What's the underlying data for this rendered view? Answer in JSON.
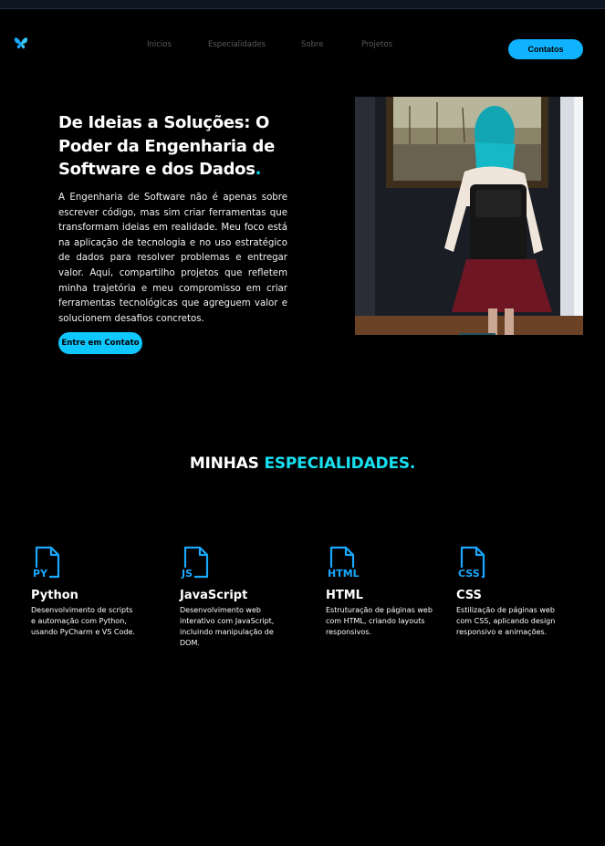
{
  "nav": {
    "items": [
      "Inicios",
      "Especialidades",
      "Sobre",
      "Projetos"
    ],
    "contact_button": "Contatos"
  },
  "hero": {
    "title": "De Ideias a Soluções: O Poder da Engenharia de Software e dos Dados",
    "title_dot": ".",
    "description": "A Engenharia de Software não é apenas sobre escrever código, mas sim criar ferramentas que transformam ideias em realidade. Meu foco está na aplicação de tecnologia e no uso estratégico de dados para resolver problemas e entregar valor. Aqui, compartilho projetos que refletem minha trajetória e meu compromisso em criar ferramentas tecnológicas que agreguem valor e solucionem desafios concretos.",
    "cta": "Entre em Contato"
  },
  "specialties": {
    "title_plain": "MINHAS",
    "title_accent": "ESPECIALIDADES.",
    "items": [
      {
        "tag": "PY",
        "title": "Python",
        "description": "Desenvolvimento de scripts e automação com Python, usando PyCharm e VS Code."
      },
      {
        "tag": "JS",
        "title": "JavaScript",
        "description": "Desenvolvimento web interativo com JavaScript, incluindo manipulação de DOM."
      },
      {
        "tag": "HTML",
        "title": "HTML",
        "description": "Estruturação de páginas web com HTML, criando layouts responsivos."
      },
      {
        "tag": "CSS",
        "title": "CSS",
        "description": "Estilização de páginas web com CSS, aplicando design responsivo e animações."
      }
    ]
  },
  "colors": {
    "accent_cyan": "#18e0f0",
    "button_blue": "#0fb3ff",
    "icon_blue": "#1aa9ff",
    "background": "#000000"
  }
}
